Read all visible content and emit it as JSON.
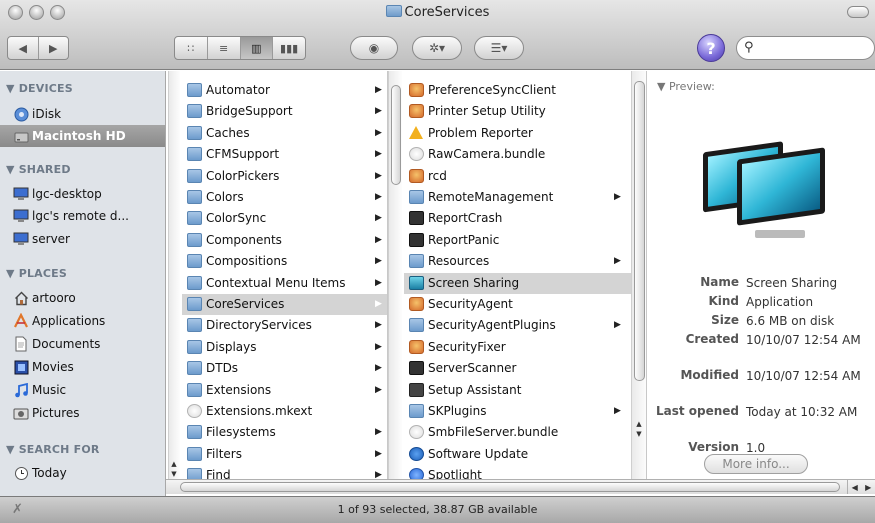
{
  "window": {
    "title": "CoreServices"
  },
  "toolbar": {
    "back_icon": "◀",
    "forward_icon": "▶",
    "view_icons": [
      "∷",
      "≡",
      "▥",
      "▮▮▮"
    ],
    "quicklook_icon": "◉",
    "action_icon": "✲▾",
    "arrange_icon": "☰▾",
    "help_icon": "?",
    "search_icon": "⚲",
    "search_value": ""
  },
  "sidebar": {
    "sections": [
      {
        "title": "▼ DEVICES",
        "items": [
          {
            "label": "iDisk",
            "icon": "globe-disk-icon"
          },
          {
            "label": "Macintosh HD",
            "icon": "hard-drive-icon",
            "selected": true
          }
        ]
      },
      {
        "title": "▼ SHARED",
        "items": [
          {
            "label": "lgc-desktop",
            "icon": "monitor-icon"
          },
          {
            "label": "lgc's remote d...",
            "icon": "monitor-icon"
          },
          {
            "label": "server",
            "icon": "monitor-icon"
          }
        ]
      },
      {
        "title": "▼ PLACES",
        "items": [
          {
            "label": "artooro",
            "icon": "home-icon"
          },
          {
            "label": "Applications",
            "icon": "applications-icon"
          },
          {
            "label": "Documents",
            "icon": "documents-icon"
          },
          {
            "label": "Movies",
            "icon": "movies-icon"
          },
          {
            "label": "Music",
            "icon": "music-icon"
          },
          {
            "label": "Pictures",
            "icon": "pictures-icon"
          }
        ]
      },
      {
        "title": "▼ SEARCH FOR",
        "items": [
          {
            "label": "Today",
            "icon": "clock-icon"
          }
        ]
      }
    ]
  },
  "column1": {
    "items": [
      {
        "label": "Automator",
        "arrow": true
      },
      {
        "label": "BridgeSupport",
        "arrow": true
      },
      {
        "label": "Caches",
        "arrow": true
      },
      {
        "label": "CFMSupport",
        "arrow": true
      },
      {
        "label": "ColorPickers",
        "arrow": true
      },
      {
        "label": "Colors",
        "arrow": true
      },
      {
        "label": "ColorSync",
        "arrow": true
      },
      {
        "label": "Components",
        "arrow": true
      },
      {
        "label": "Compositions",
        "arrow": true
      },
      {
        "label": "Contextual Menu Items",
        "arrow": true
      },
      {
        "label": "CoreServices",
        "arrow": true,
        "selected": true
      },
      {
        "label": "DirectoryServices",
        "arrow": true
      },
      {
        "label": "Displays",
        "arrow": true
      },
      {
        "label": "DTDs",
        "arrow": true
      },
      {
        "label": "Extensions",
        "arrow": true
      },
      {
        "label": "Extensions.mkext",
        "arrow": false,
        "kind": "bundle"
      },
      {
        "label": "Filesystems",
        "arrow": true
      },
      {
        "label": "Filters",
        "arrow": true
      },
      {
        "label": "Find",
        "arrow": true
      }
    ]
  },
  "column2": {
    "items": [
      {
        "label": "PreferenceSyncClient",
        "arrow": false,
        "kind": "app"
      },
      {
        "label": "Printer Setup Utility",
        "arrow": false,
        "kind": "app"
      },
      {
        "label": "Problem Reporter",
        "arrow": false,
        "kind": "warn"
      },
      {
        "label": "RawCamera.bundle",
        "arrow": false,
        "kind": "bundle"
      },
      {
        "label": "rcd",
        "arrow": false,
        "kind": "app"
      },
      {
        "label": "RemoteManagement",
        "arrow": true,
        "kind": "folder"
      },
      {
        "label": "ReportCrash",
        "arrow": false,
        "kind": "term"
      },
      {
        "label": "ReportPanic",
        "arrow": false,
        "kind": "term"
      },
      {
        "label": "Resources",
        "arrow": true,
        "kind": "folder"
      },
      {
        "label": "Screen Sharing",
        "arrow": false,
        "kind": "screen",
        "selected": true
      },
      {
        "label": "SecurityAgent",
        "arrow": false,
        "kind": "app"
      },
      {
        "label": "SecurityAgentPlugins",
        "arrow": true,
        "kind": "folder"
      },
      {
        "label": "SecurityFixer",
        "arrow": false,
        "kind": "app"
      },
      {
        "label": "ServerScanner",
        "arrow": false,
        "kind": "term"
      },
      {
        "label": "Setup Assistant",
        "arrow": false,
        "kind": "setup"
      },
      {
        "label": "SKPlugins",
        "arrow": true,
        "kind": "folder"
      },
      {
        "label": "SmbFileServer.bundle",
        "arrow": false,
        "kind": "bundle"
      },
      {
        "label": "Software Update",
        "arrow": false,
        "kind": "blueg"
      },
      {
        "label": "Spotlight",
        "arrow": false,
        "kind": "spot"
      }
    ]
  },
  "preview": {
    "header": "▼ Preview:",
    "meta": [
      {
        "key": "Name",
        "value": "Screen Sharing"
      },
      {
        "key": "Kind",
        "value": "Application"
      },
      {
        "key": "Size",
        "value": "6.6 MB on disk"
      },
      {
        "key": "Created",
        "value": "10/10/07 12:54 AM"
      },
      {
        "key": "Modified",
        "value": "10/10/07 12:54 AM"
      },
      {
        "key": "Last opened",
        "value": "Today at 10:32 AM"
      },
      {
        "key": "Version",
        "value": "1.0"
      }
    ],
    "more_info_label": "More info..."
  },
  "statusbar": {
    "text": "1 of 93 selected, 38.87 GB available"
  }
}
